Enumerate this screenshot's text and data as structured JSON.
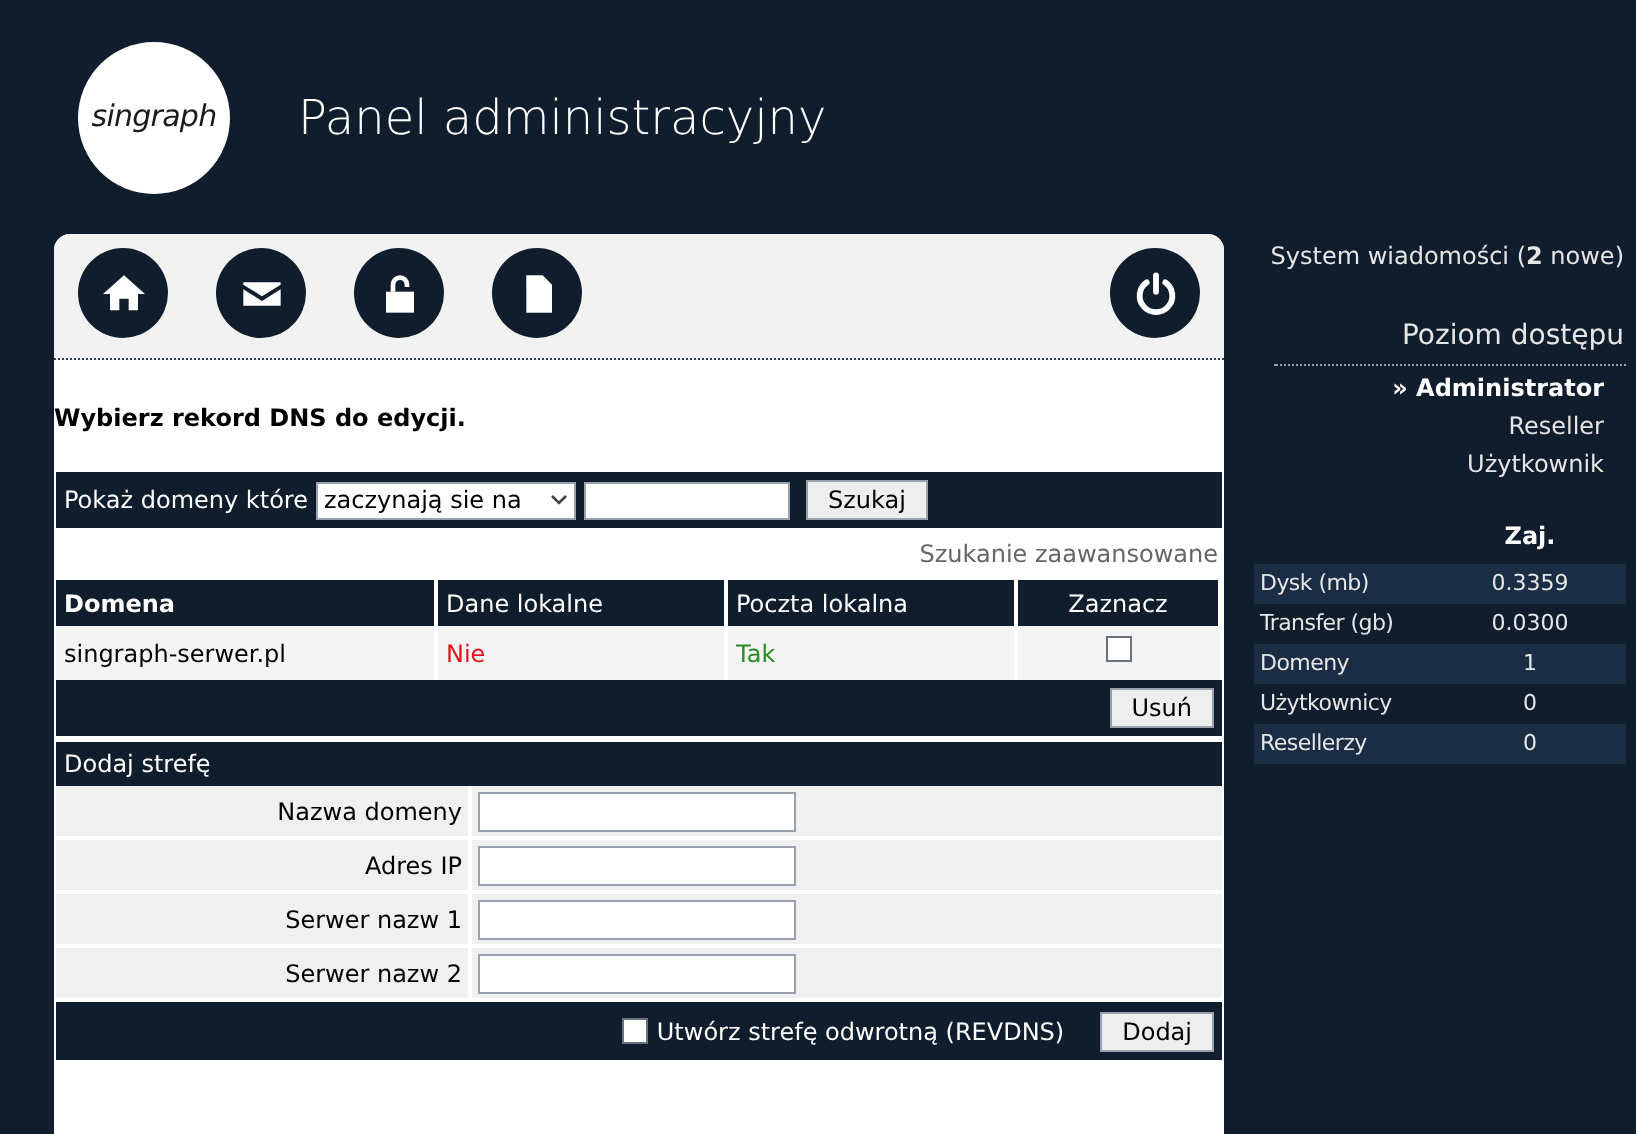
{
  "header": {
    "logo": "singraph",
    "title": "Panel administracyjny"
  },
  "toolbar": [
    {
      "kind": "home"
    },
    {
      "kind": "mail"
    },
    {
      "kind": "unlock"
    },
    {
      "kind": "file"
    },
    {
      "kind": "power"
    }
  ],
  "heading": "Wybierz rekord DNS do edycji.",
  "filter": {
    "label": "Pokaż domeny które",
    "select": "zaczynają sie na",
    "button": "Szukaj"
  },
  "advanced_link": "Szukanie zaawansowane",
  "table": {
    "columns": [
      "Domena",
      "Dane lokalne",
      "Poczta lokalna",
      "Zaznacz"
    ],
    "rows": [
      {
        "domain": "singraph-serwer.pl",
        "local_data": {
          "text": "Nie",
          "color": "#e8101a"
        },
        "local_mail": {
          "text": "Tak",
          "color": "#2a8a2a"
        },
        "checked": false
      }
    ],
    "delete_button": "Usuń"
  },
  "add_zone": {
    "title": "Dodaj strefę",
    "fields": [
      "Nazwa domeny",
      "Adres IP",
      "Serwer nazw 1",
      "Serwer nazw 2"
    ],
    "reverse_label": "Utwórz strefę odwrotną (REVDNS)",
    "reverse_checked": false,
    "button": "Dodaj"
  },
  "sidebar": {
    "messages": {
      "prefix": "System wiadomości (",
      "count": "2",
      "suffix": " nowe)"
    },
    "access_title": "Poziom dostępu",
    "marker": "»",
    "levels": [
      {
        "label": "Administrator",
        "selected": true
      },
      {
        "label": "Reseller",
        "selected": false
      },
      {
        "label": "Użytkownik",
        "selected": false
      }
    ],
    "stats_header": "Zaj.",
    "stats": [
      {
        "label": "Dysk (mb)",
        "value": "0.3359"
      },
      {
        "label": "Transfer (gb)",
        "value": "0.0300"
      },
      {
        "label": "Domeny",
        "value": "1"
      },
      {
        "label": "Użytkownicy",
        "value": "0"
      },
      {
        "label": "Resellerzy",
        "value": "0"
      }
    ]
  }
}
